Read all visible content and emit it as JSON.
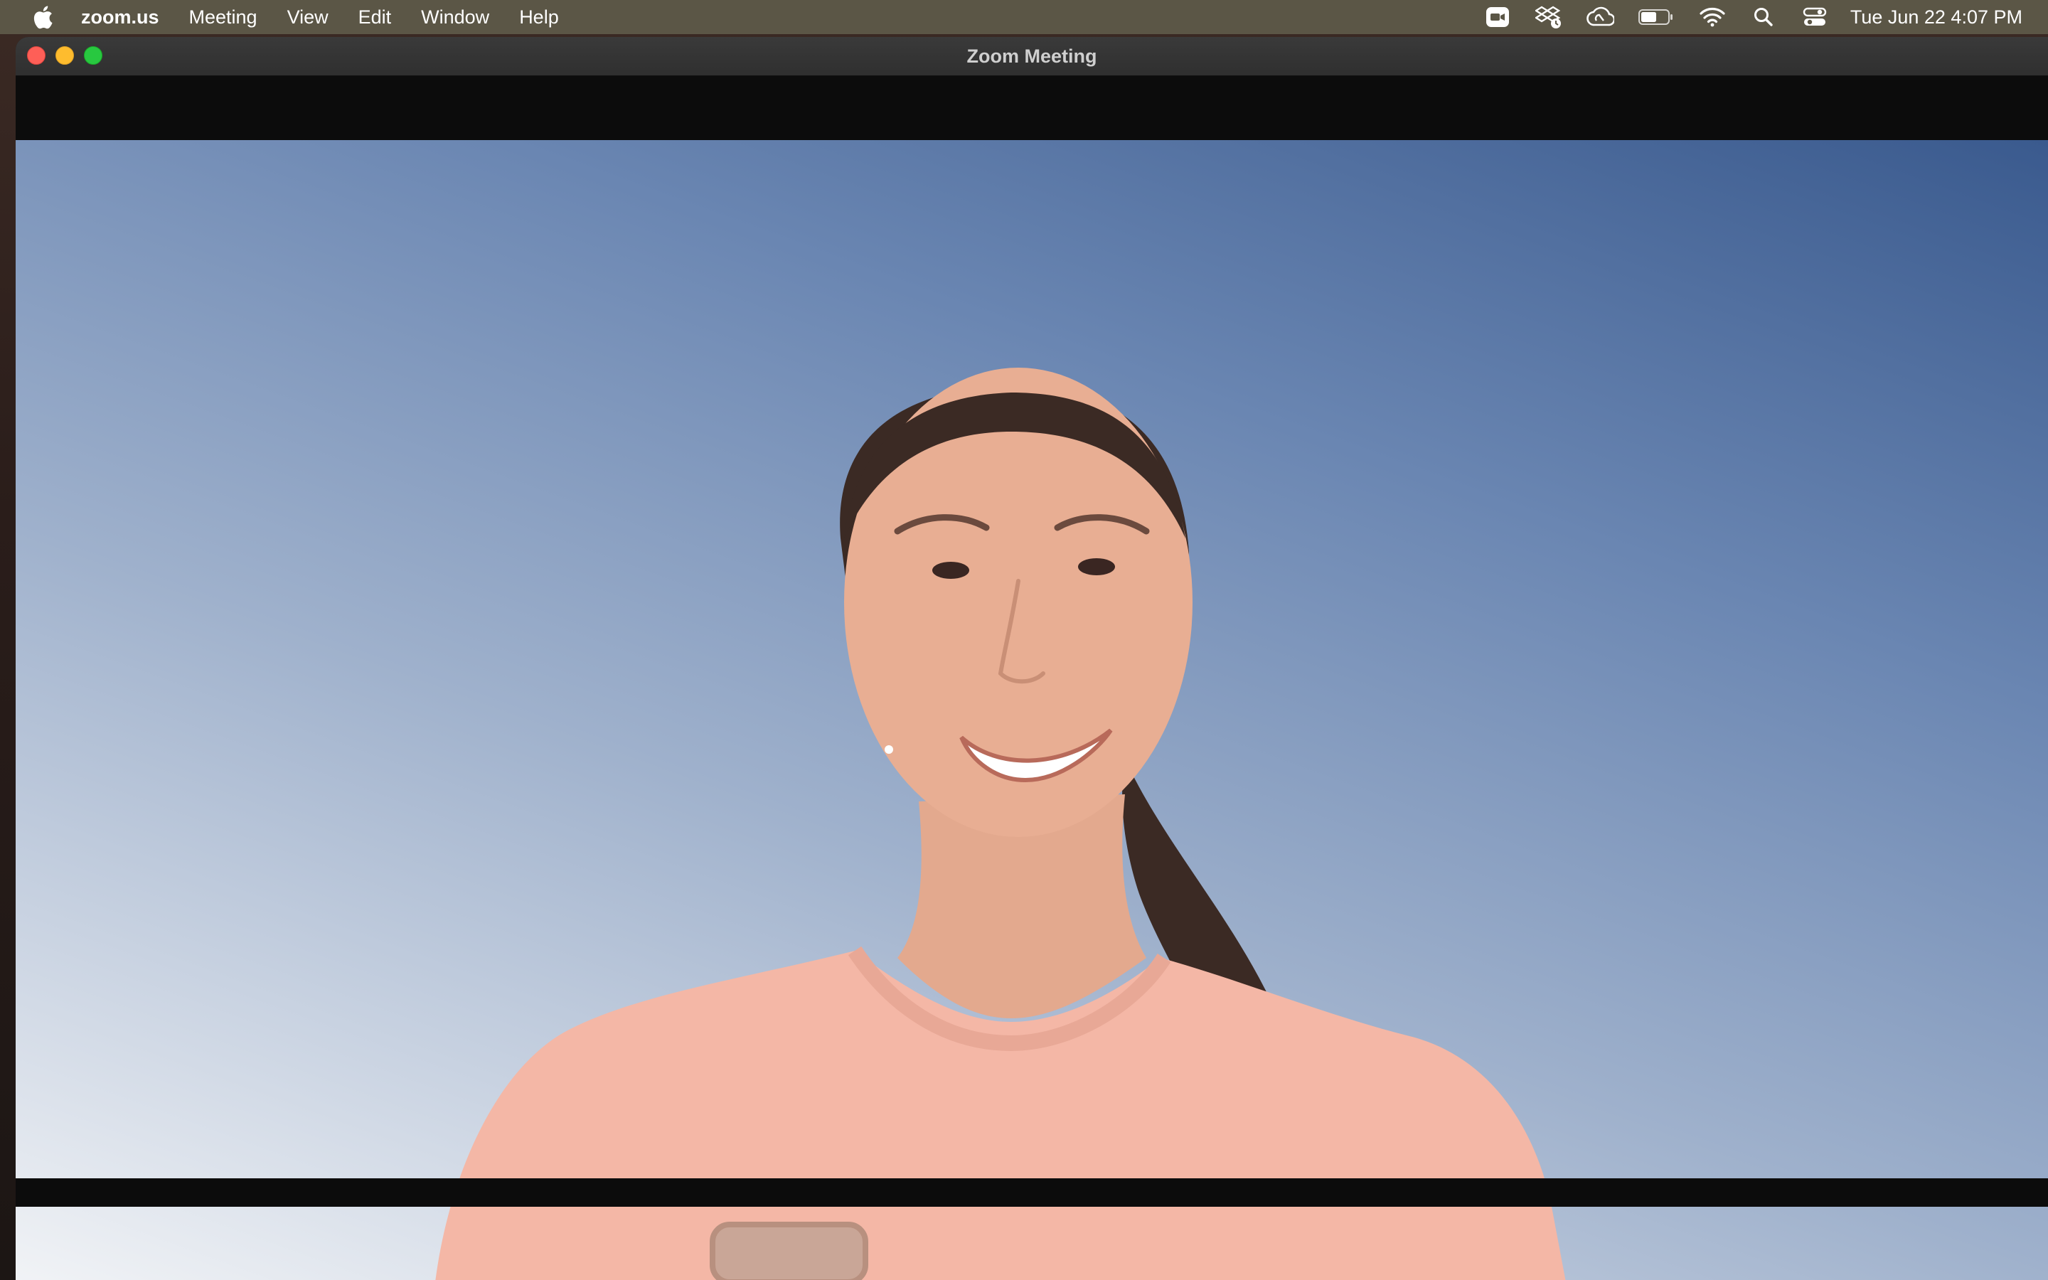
{
  "menubar": {
    "apple_icon": "apple-icon",
    "app_name": "zoom.us",
    "items": [
      "Meeting",
      "View",
      "Edit",
      "Window",
      "Help"
    ],
    "status_icons": [
      "zoom-app-icon",
      "dropbox-icon",
      "creative-cloud-icon",
      "battery-icon",
      "wifi-icon",
      "spotlight-search-icon",
      "control-center-icon"
    ],
    "clock": "Tue Jun 22  4:07 PM"
  },
  "window": {
    "title": "Zoom Meeting"
  },
  "video": {
    "subject": "participant-video"
  },
  "colors": {
    "menubar": "#5b5646",
    "close": "#fe5f57",
    "minimize": "#febc2e",
    "zoom": "#28c840",
    "background_top": "#3a5a8e",
    "background_bottom": "#f1f3f6",
    "sweatshirt": "#f4b7a6"
  }
}
